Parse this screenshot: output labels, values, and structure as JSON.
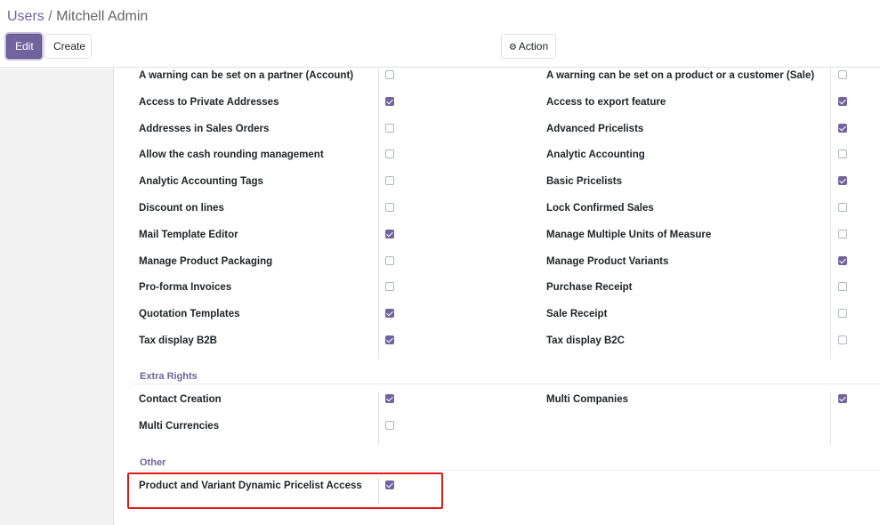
{
  "breadcrumb": {
    "parent": "Users",
    "separator": "/",
    "current": "Mitchell Admin"
  },
  "toolbar": {
    "edit_label": "Edit",
    "create_label": "Create",
    "action_label": "Action",
    "action_icon": "gear-icon"
  },
  "accent_color": "#71639e",
  "highlight_color": "#e01818",
  "technical": {
    "left": [
      {
        "label": "A warning can be set on a partner (Account)",
        "checked": false
      },
      {
        "label": "Access to Private Addresses",
        "checked": true
      },
      {
        "label": "Addresses in Sales Orders",
        "checked": false
      },
      {
        "label": "Allow the cash rounding management",
        "checked": false
      },
      {
        "label": "Analytic Accounting Tags",
        "checked": false
      },
      {
        "label": "Discount on lines",
        "checked": false
      },
      {
        "label": "Mail Template Editor",
        "checked": true
      },
      {
        "label": "Manage Product Packaging",
        "checked": false
      },
      {
        "label": "Pro-forma Invoices",
        "checked": false
      },
      {
        "label": "Quotation Templates",
        "checked": true
      },
      {
        "label": "Tax display B2B",
        "checked": true
      }
    ],
    "right": [
      {
        "label": "A warning can be set on a product or a customer (Sale)",
        "checked": false
      },
      {
        "label": "Access to export feature",
        "checked": true
      },
      {
        "label": "Advanced Pricelists",
        "checked": true
      },
      {
        "label": "Analytic Accounting",
        "checked": false
      },
      {
        "label": "Basic Pricelists",
        "checked": true
      },
      {
        "label": "Lock Confirmed Sales",
        "checked": false
      },
      {
        "label": "Manage Multiple Units of Measure",
        "checked": false
      },
      {
        "label": "Manage Product Variants",
        "checked": true
      },
      {
        "label": "Purchase Receipt",
        "checked": false
      },
      {
        "label": "Sale Receipt",
        "checked": false
      },
      {
        "label": "Tax display B2C",
        "checked": false
      }
    ]
  },
  "extra_rights": {
    "title": "Extra Rights",
    "left": [
      {
        "label": "Contact Creation",
        "checked": true
      },
      {
        "label": "Multi Currencies",
        "checked": false
      }
    ],
    "right": [
      {
        "label": "Multi Companies",
        "checked": true
      }
    ]
  },
  "other": {
    "title": "Other",
    "left": [
      {
        "label": "Product and Variant Dynamic Pricelist Access",
        "checked": true
      }
    ]
  }
}
